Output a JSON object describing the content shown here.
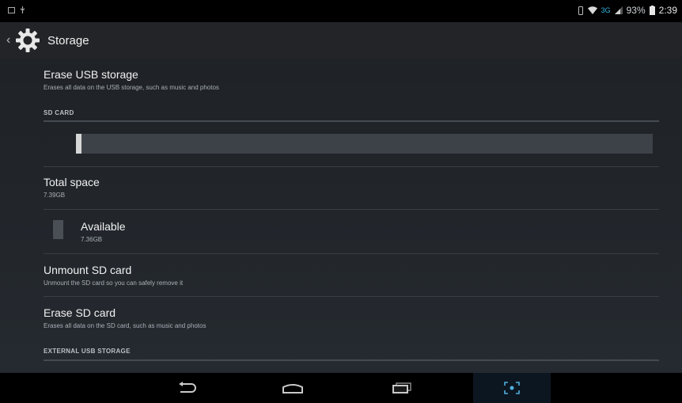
{
  "status_bar": {
    "time": "2:39",
    "battery_percent": "93%",
    "network": "3G",
    "icons": [
      "screenshot-icon",
      "usb-icon",
      "vibrate-icon",
      "wifi-icon",
      "signal-icon",
      "battery-icon"
    ]
  },
  "action_bar": {
    "title": "Storage",
    "icons": [
      "up-chevron-icon",
      "settings-gear-icon"
    ]
  },
  "preferences": {
    "erase_usb": {
      "title": "Erase USB storage",
      "summary": "Erases all data on the USB storage, such as music and photos"
    },
    "sd_card_header": "SD CARD",
    "storage_bar": {
      "used_fraction": 0.01
    },
    "total_space": {
      "title": "Total space",
      "value": "7.39GB"
    },
    "available": {
      "title": "Available",
      "value": "7.36GB"
    },
    "unmount_sd": {
      "title": "Unmount SD card",
      "summary": "Unmount the SD card so you can safely remove it"
    },
    "erase_sd": {
      "title": "Erase SD card",
      "summary": "Erases all data on the SD card, such as music and photos"
    },
    "external_usb_header": "EXTERNAL USB STORAGE"
  },
  "nav_bar": {
    "buttons": [
      "back-icon",
      "home-icon",
      "recent-apps-icon",
      "screenshot-capture-icon"
    ]
  },
  "colors": {
    "background": "#1b1e22",
    "accent": "#33b5e5",
    "storage_fill": "#d6d6d6"
  }
}
